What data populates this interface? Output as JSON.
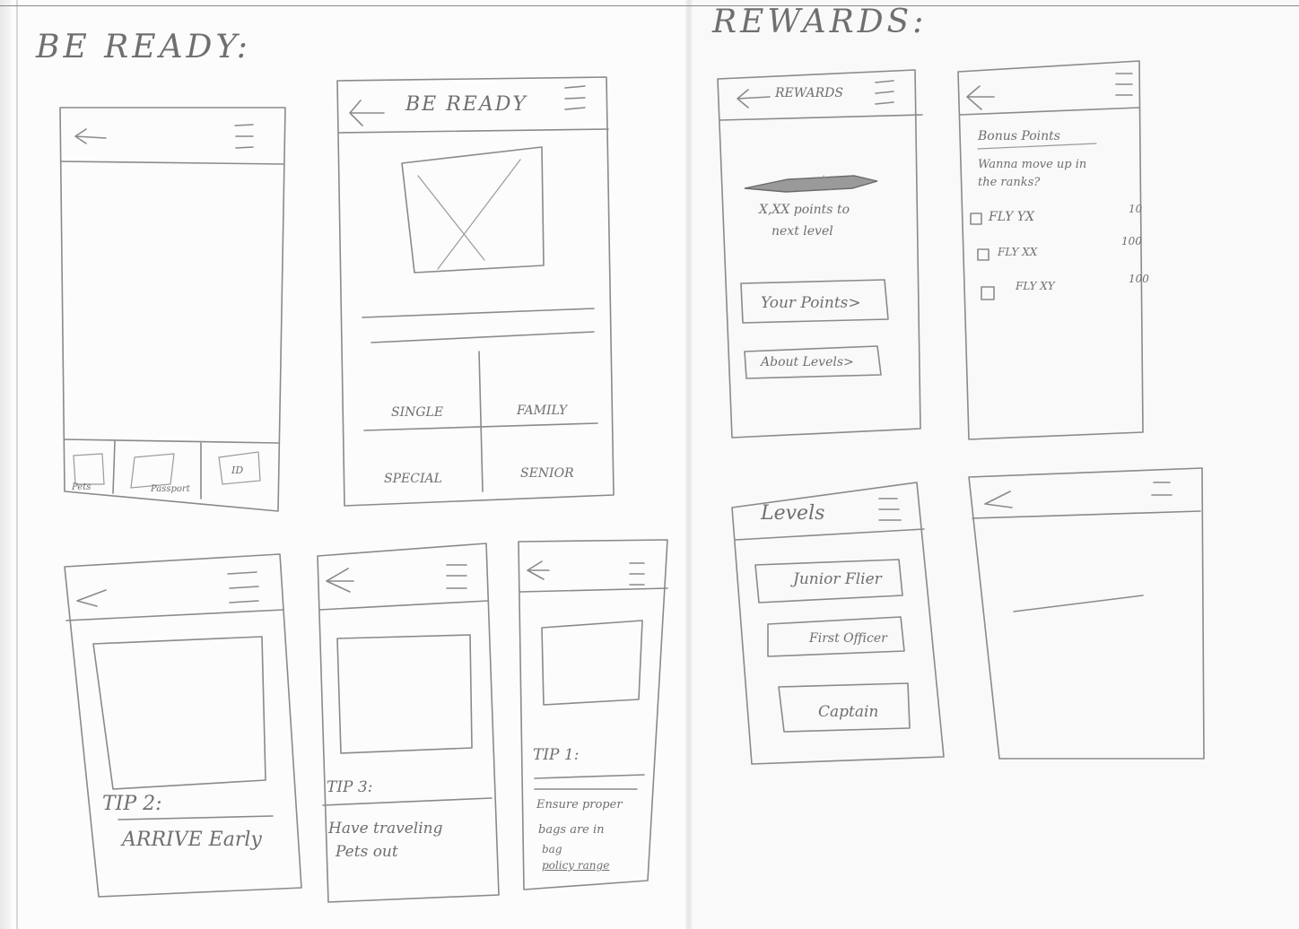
{
  "sections": {
    "be_ready_title": "BE READY:",
    "rewards_title": "REWARDS:"
  },
  "be_ready": {
    "home_screen": {
      "tab_labels": [
        "Pets",
        "Passport",
        "ID"
      ]
    },
    "be_ready_screen": {
      "header_title": "BE READY",
      "cells": [
        "SINGLE",
        "FAMILY",
        "SPECIAL",
        "SENIOR"
      ]
    },
    "tip_screens": [
      {
        "label": "TIP 2:",
        "text": "ARRIVE Early"
      },
      {
        "label": "TIP 3:",
        "lines": [
          "Have traveling",
          "Pets out"
        ]
      },
      {
        "label": "TIP 1:",
        "lines": [
          "Ensure proper",
          "bags are in",
          "bag",
          "policy range"
        ]
      }
    ]
  },
  "rewards": {
    "rewards_screen": {
      "header_title": "REWARDS",
      "points_text_lines": [
        "X,XX points to",
        "next level"
      ],
      "your_points_button": "Your Points>",
      "about_levels_button": "About Levels>"
    },
    "bonus_points_screen": {
      "title": "Bonus Points",
      "subtitle_lines": [
        "Wanna move up in",
        "the ranks?"
      ],
      "items": [
        {
          "label": "FLY YX",
          "points": "10"
        },
        {
          "label": "FLY XX",
          "points": "100"
        },
        {
          "label": "FLY XY",
          "points": "100"
        }
      ]
    },
    "levels_screen": {
      "header_title": "Levels",
      "levels": [
        "Junior Flier",
        "First Officer",
        "Captain"
      ]
    }
  },
  "icons": {
    "back": "back-arrow-icon",
    "menu": "hamburger-menu-icon",
    "image_placeholder": "image-placeholder-icon",
    "airplane": "airplane-icon",
    "checkbox": "checkbox-icon"
  }
}
